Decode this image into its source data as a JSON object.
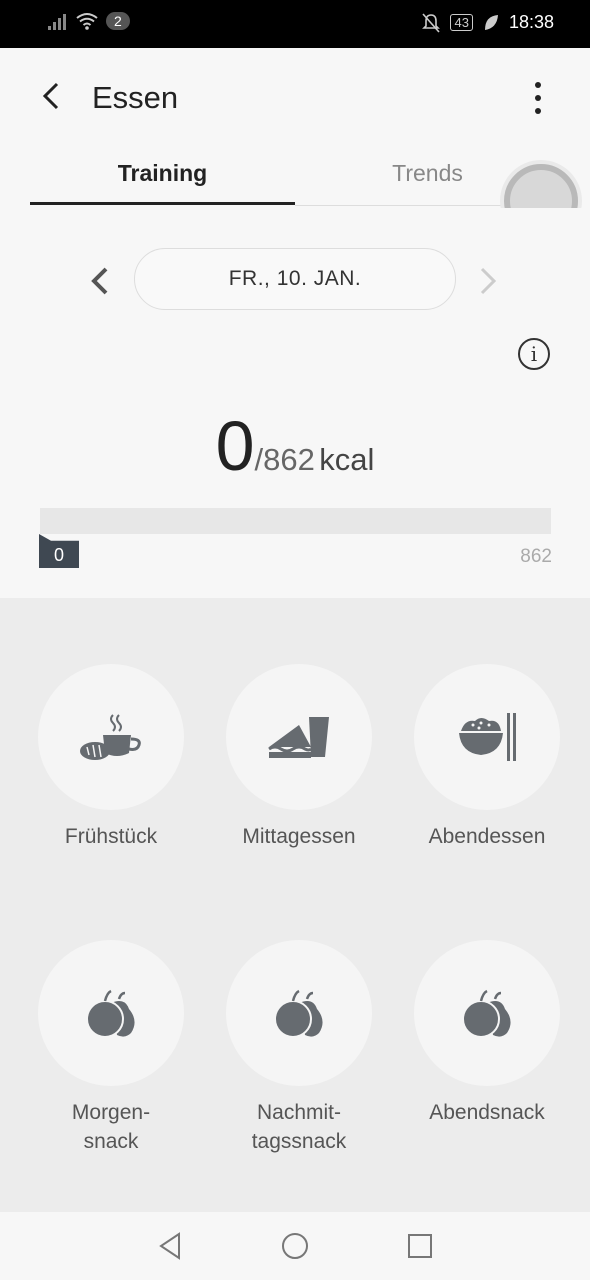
{
  "status_bar": {
    "notification_count": "2",
    "battery": "43",
    "time": "18:38"
  },
  "header": {
    "title": "Essen"
  },
  "tabs": [
    {
      "label": "Training",
      "active": true
    },
    {
      "label": "Trends",
      "active": false
    }
  ],
  "date": {
    "label": "FR., 10. JAN."
  },
  "calories": {
    "current": "0",
    "goal": "/862",
    "unit": "kcal",
    "progress_fraction": 0
  },
  "progress": {
    "min_label": "0",
    "max_label": "862"
  },
  "meals": [
    {
      "label": "Frühstück",
      "icon": "breakfast-icon"
    },
    {
      "label": "Mittagessen",
      "icon": "sandwich-icon"
    },
    {
      "label": "Abendessen",
      "icon": "rice-bowl-icon"
    },
    {
      "label": "Morgen-\nsnack",
      "icon": "fruit-icon"
    },
    {
      "label": "Nachmit-\ntagssnack",
      "icon": "fruit-icon"
    },
    {
      "label": "Abendsnack",
      "icon": "fruit-icon"
    }
  ],
  "colors": {
    "accent": "#3f4852",
    "icon_gray": "#666b70"
  }
}
